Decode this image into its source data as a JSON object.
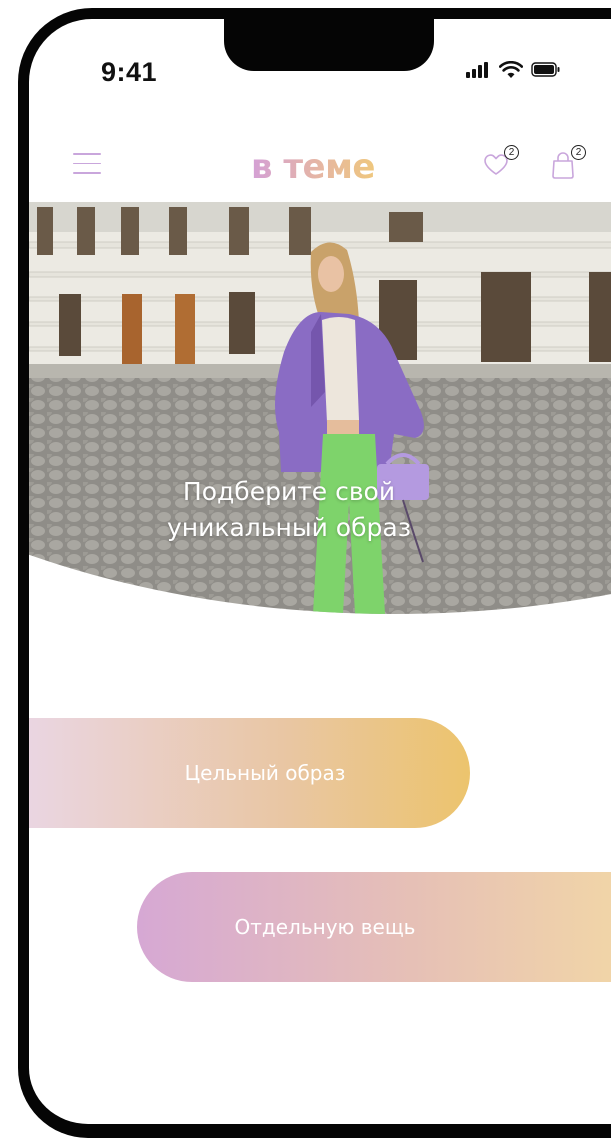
{
  "status_bar": {
    "time": "9:41"
  },
  "header": {
    "logo": "в теме",
    "wishlist_count": "2",
    "cart_count": "2"
  },
  "hero": {
    "headline_line1": "Подберите свой",
    "headline_line2": "уникальный образ"
  },
  "options": {
    "whole_outfit": "Цельный образ",
    "single_item": "Отдельную вещь"
  },
  "colors": {
    "accent_lilac": "#c9a6dc",
    "accent_gold": "#ecc46d"
  }
}
